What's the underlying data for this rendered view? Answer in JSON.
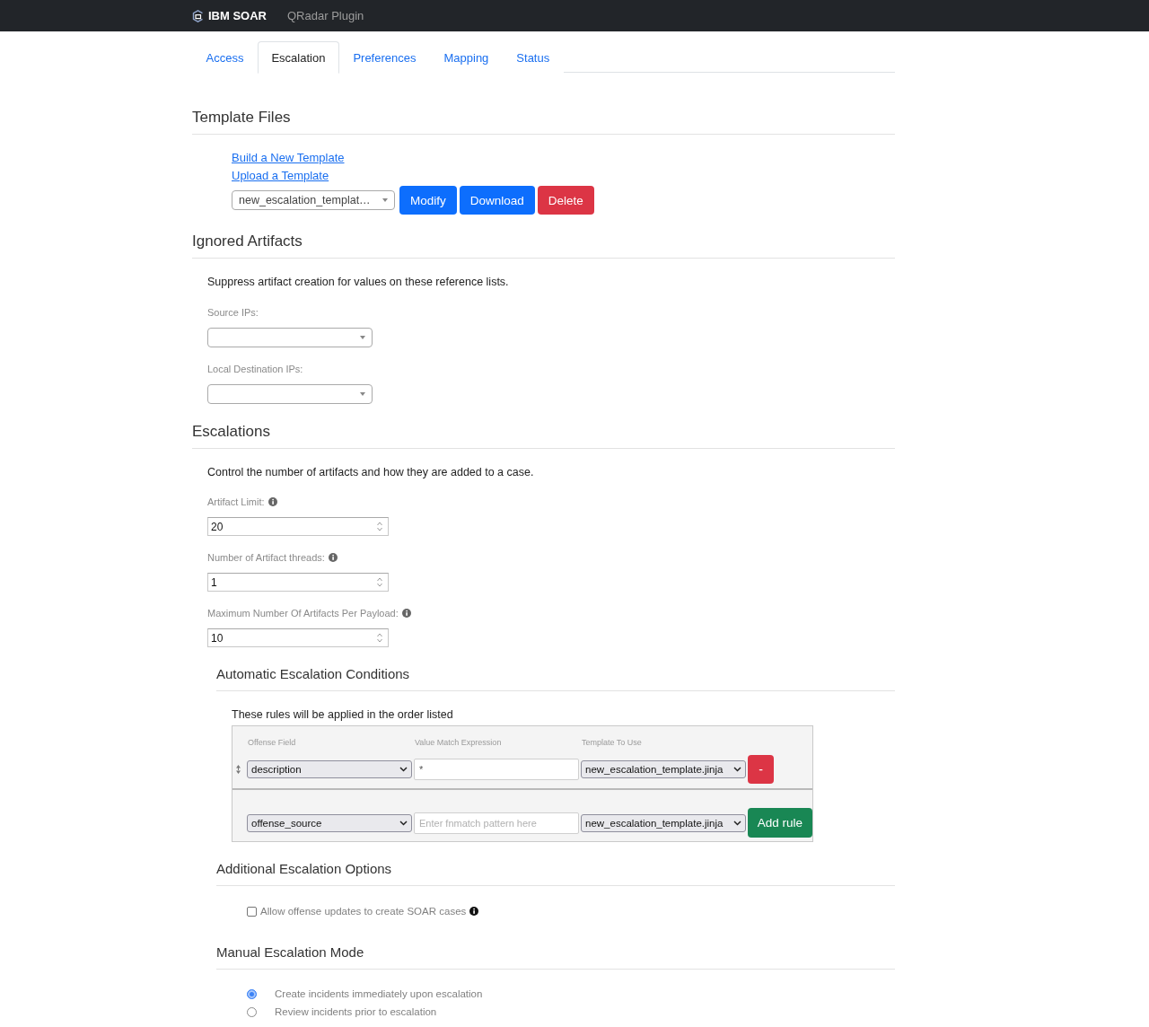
{
  "navbar": {
    "brand": "IBM SOAR",
    "title": "QRadar Plugin"
  },
  "tabs": [
    {
      "label": "Access",
      "selected": false
    },
    {
      "label": "Escalation",
      "selected": true
    },
    {
      "label": "Preferences",
      "selected": false
    },
    {
      "label": "Mapping",
      "selected": false
    },
    {
      "label": "Status",
      "selected": false
    }
  ],
  "template_files": {
    "heading": "Template Files",
    "links": [
      "Build a New Template",
      "Upload a Template"
    ],
    "template_select": {
      "value": "new_escalation_templat…"
    },
    "buttons": [
      {
        "label": "Modify",
        "kind": "primary"
      },
      {
        "label": "Download",
        "kind": "primary"
      },
      {
        "label": "Delete",
        "kind": "danger"
      }
    ]
  },
  "ignored_artifacts": {
    "heading": "Ignored Artifacts",
    "description": "Suppress artifact creation for values on these reference lists.",
    "fields": [
      {
        "label": "Source IPs:"
      },
      {
        "label": "Local Destination IPs:"
      }
    ]
  },
  "escalations": {
    "heading": "Escalations",
    "description": "Control the number of artifacts and how they are added to a case.",
    "fields": [
      {
        "label": "Artifact Limit:",
        "value": "20"
      },
      {
        "label": "Number of Artifact threads:",
        "value": "1"
      },
      {
        "label": "Maximum Number Of Artifacts Per Payload:",
        "value": "10"
      }
    ]
  },
  "automatic_conditions": {
    "heading": "Automatic Escalation Conditions",
    "note": "These rules will be applied in the order listed",
    "columns": [
      "Offense Field",
      "Value Match Expression",
      "Template To Use"
    ],
    "rows": [
      {
        "kind": "rule",
        "offense_field": "description",
        "expression": "*",
        "template": "new_escalation_template.jinja",
        "action": {
          "label": "-",
          "kind": "danger"
        }
      },
      {
        "kind": "new",
        "offense_field": "offense_source",
        "placeholder": "Enter fnmatch pattern here",
        "template": "new_escalation_template.jinja",
        "action": {
          "label": "Add rule",
          "kind": "success"
        }
      }
    ]
  },
  "additional_options": {
    "heading": "Additional Escalation Options",
    "options": [
      {
        "label": "Allow offense updates to create SOAR cases",
        "checked": false
      }
    ]
  },
  "manual_mode": {
    "heading": "Manual Escalation Mode",
    "options": [
      {
        "label": "Create incidents immediately upon escalation",
        "selected": true
      },
      {
        "label": "Review incidents prior to escalation",
        "selected": false
      }
    ]
  }
}
